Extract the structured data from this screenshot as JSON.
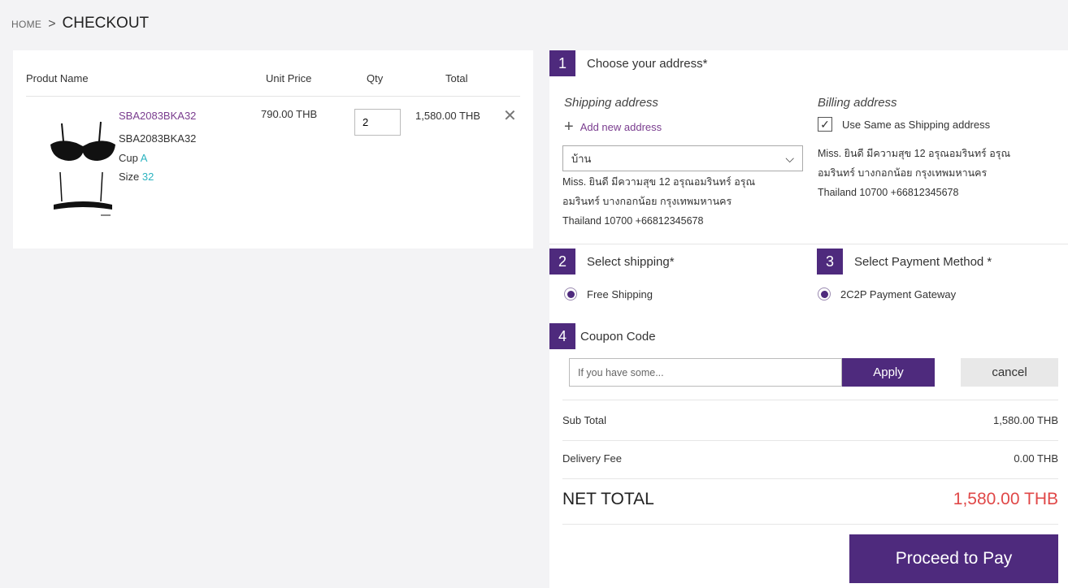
{
  "breadcrumb": {
    "home": "HOME",
    "separator": ">",
    "current": "CHECKOUT"
  },
  "cart": {
    "headers": {
      "name": "Produt Name",
      "unit_price": "Unit Price",
      "qty": "Qty",
      "total": "Total"
    },
    "item": {
      "code_link": "SBA2083BKA32",
      "code": "SBA2083BKA32",
      "cup_label": "Cup",
      "cup_value": "A",
      "size_label": "Size",
      "size_value": "32",
      "unit_price": "790.00 THB",
      "qty": "2",
      "total": "1,580.00 THB",
      "remove_glyph": "✕"
    }
  },
  "steps": {
    "address": {
      "num": "1",
      "title": "Choose your address*"
    },
    "shipping": {
      "num": "2",
      "title": "Select shipping*"
    },
    "payment": {
      "num": "3",
      "title": "Select Payment Method *"
    },
    "coupon": {
      "num": "4",
      "title": "Coupon Code"
    }
  },
  "address": {
    "shipping_title": "Shipping address",
    "billing_title": "Billing address",
    "add_new": "Add new address",
    "use_same": "Use Same as Shipping address",
    "selected": "บ้าน",
    "shipping_lines": [
      "Miss. ยินดี มีความสุข 12 อรุณอมรินทร์ อรุณ",
      "อมรินทร์ บางกอกน้อย กรุงเทพมหานคร",
      "Thailand 10700 +66812345678"
    ],
    "billing_lines": [
      "Miss. ยินดี มีความสุข 12 อรุณอมรินทร์ อรุณ",
      "อมรินทร์ บางกอกน้อย กรุงเทพมหานคร",
      "Thailand 10700 +66812345678"
    ]
  },
  "shipping": {
    "option": "Free Shipping"
  },
  "payment": {
    "option": "2C2P Payment Gateway"
  },
  "coupon": {
    "placeholder": "If you have some...",
    "apply": "Apply",
    "cancel": "cancel"
  },
  "summary": {
    "subtotal_label": "Sub Total",
    "subtotal_value": "1,580.00 THB",
    "delivery_label": "Delivery Fee",
    "delivery_value": "0.00 THB",
    "net_label": "NET TOTAL",
    "net_value": "1,580.00 THB"
  },
  "pay_button": "Proceed to Pay",
  "colors": {
    "brand_purple": "#4e2a7d",
    "link_purple": "#7a3d8f",
    "teal": "#2bb3c0",
    "net_red": "#e04848"
  }
}
